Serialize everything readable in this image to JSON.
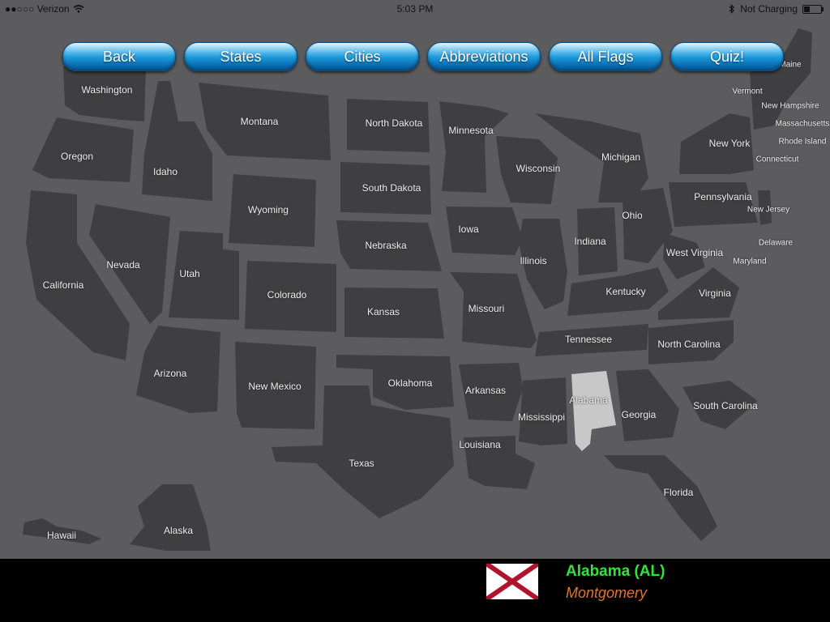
{
  "status_bar": {
    "carrier": "●●○○○ Verizon",
    "time": "5:03 PM",
    "charging": "Not Charging"
  },
  "nav": {
    "back": "Back",
    "states": "States",
    "cities": "Cities",
    "abbreviations": "Abbreviations",
    "all_flags": "All Flags",
    "quiz": "Quiz!"
  },
  "map_labels": {
    "washington": "Washington",
    "oregon": "Oregon",
    "california": "California",
    "idaho": "Idaho",
    "nevada": "Nevada",
    "montana": "Montana",
    "wyoming": "Wyoming",
    "utah": "Utah",
    "arizona": "Arizona",
    "colorado": "Colorado",
    "new_mexico": "New Mexico",
    "north_dakota": "North Dakota",
    "south_dakota": "South Dakota",
    "nebraska": "Nebraska",
    "kansas": "Kansas",
    "oklahoma": "Oklahoma",
    "texas": "Texas",
    "minnesota": "Minnesota",
    "iowa": "Iowa",
    "missouri": "Missouri",
    "arkansas": "Arkansas",
    "louisiana": "Louisiana",
    "wisconsin": "Wisconsin",
    "illinois": "Illinois",
    "michigan": "Michigan",
    "indiana": "Indiana",
    "ohio": "Ohio",
    "kentucky": "Kentucky",
    "tennessee": "Tennessee",
    "mississippi": "Mississippi",
    "alabama": "Alabama",
    "georgia": "Georgia",
    "florida": "Florida",
    "south_carolina": "South Carolina",
    "north_carolina": "North Carolina",
    "virginia": "Virginia",
    "west_virginia": "West Virginia",
    "pennsylvania": "Pennsylvania",
    "new_york": "New York",
    "vermont": "Vermont",
    "new_hampshire": "New Hampshire",
    "maine": "Maine",
    "massachusetts": "Massachusetts",
    "rhode_island": "Rhode Island",
    "connecticut": "Connecticut",
    "new_jersey": "New Jersey",
    "delaware": "Delaware",
    "maryland": "Maryland",
    "alaska": "Alaska",
    "hawaii": "Hawaii"
  },
  "selected": {
    "state": "Alabama (AL)",
    "capital": "Montgomery",
    "name_color": "#2ee63a",
    "capital_color": "#e8732a"
  },
  "colors": {
    "background": "#5c5c5e",
    "state_fill": "#3f3f41",
    "selected_fill": "#c8c8c8",
    "button_blue": "#1f9ddd"
  }
}
